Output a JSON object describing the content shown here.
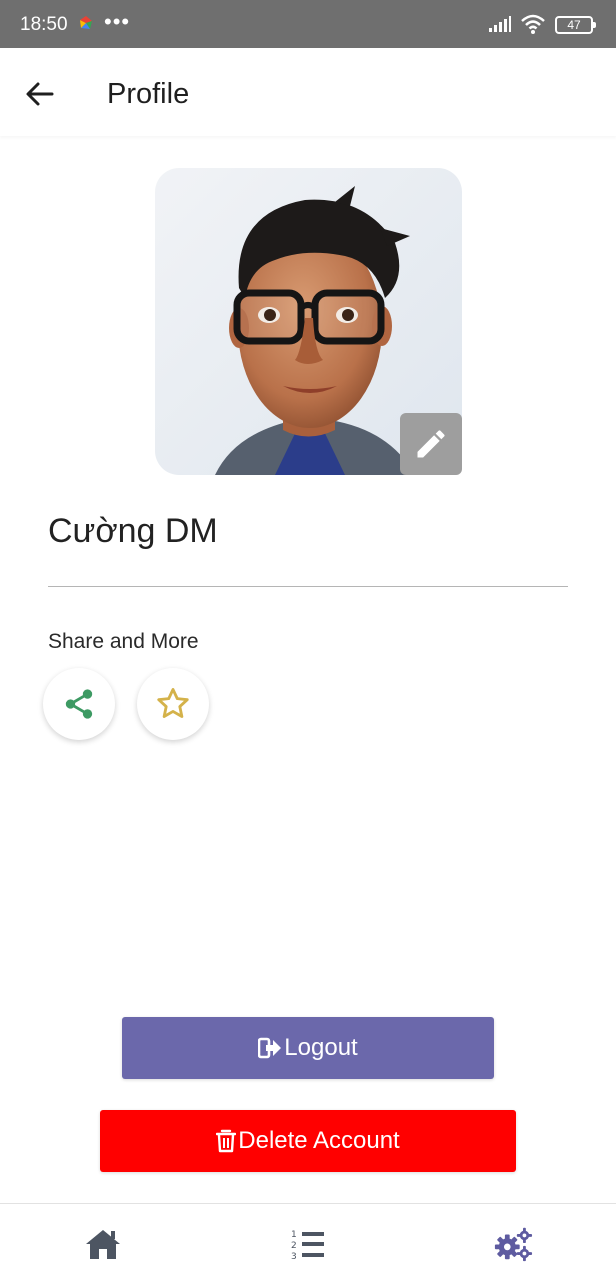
{
  "status_bar": {
    "time": "18:50",
    "dots": "•••",
    "battery": "47"
  },
  "header": {
    "title": "Profile",
    "back_icon": "arrow-left-icon"
  },
  "profile": {
    "name": "Cường DM",
    "avatar_edit_icon": "pencil-icon"
  },
  "share_section": {
    "label": "Share and More",
    "buttons": [
      {
        "icon": "share-icon",
        "color": "#3d9a63"
      },
      {
        "icon": "star-outline-icon",
        "color": "#d4b24a"
      }
    ]
  },
  "actions": {
    "logout_label": "Logout",
    "logout_color": "#6b68ab",
    "delete_label": "Delete Account",
    "delete_color": "#ff0000"
  },
  "bottom_nav": {
    "items": [
      {
        "icon": "home-icon",
        "active": false
      },
      {
        "icon": "numbered-list-icon",
        "active": false
      },
      {
        "icon": "settings-gears-icon",
        "active": true
      }
    ],
    "active_color": "#5e5ba0",
    "inactive_color": "#4d5562"
  }
}
